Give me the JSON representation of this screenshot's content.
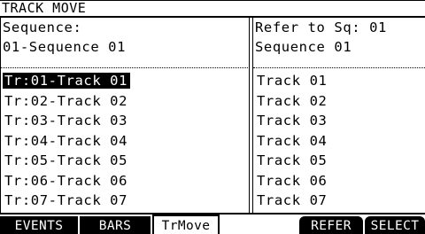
{
  "title": "TRACK MOVE",
  "left_pane": {
    "label": "Sequence:",
    "sequence": "01-Sequence 01",
    "tracks": [
      "Tr:01-Track 01",
      "Tr:02-Track 02",
      "Tr:03-Track 03",
      "Tr:04-Track 04",
      "Tr:05-Track 05",
      "Tr:06-Track 06",
      "Tr:07-Track 07"
    ]
  },
  "right_pane": {
    "label": "Refer to Sq: 01",
    "sequence": "Sequence 01",
    "tracks": [
      "Track 01",
      "Track 02",
      "Track 03",
      "Track 04",
      "Track 05",
      "Track 06",
      "Track 07"
    ]
  },
  "tabs": {
    "events": "EVENTS",
    "bars": "BARS",
    "trmove": "TrMove",
    "refer": "REFER",
    "select": "SELECT"
  },
  "colors": {
    "foreground": "#000000",
    "background": "#ffffff"
  }
}
